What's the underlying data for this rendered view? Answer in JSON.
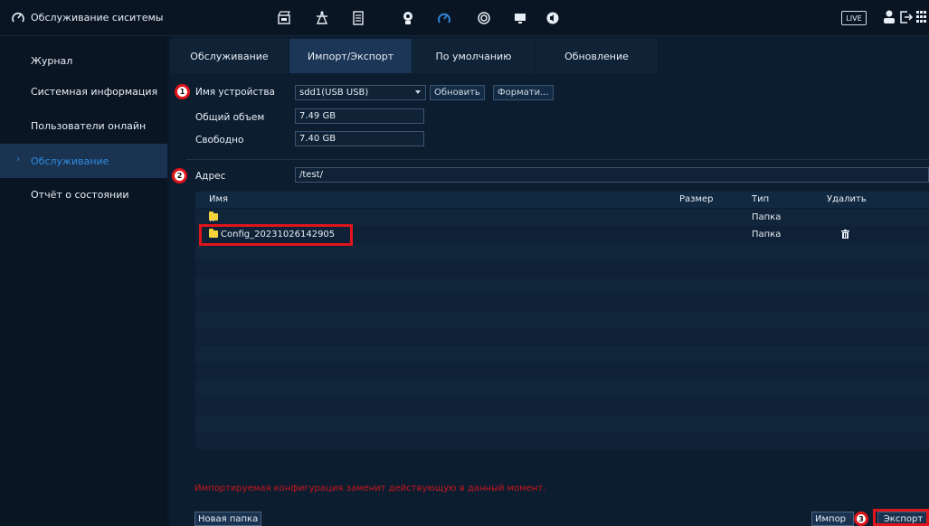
{
  "window": {
    "title": "Обслуживание сиситемы"
  },
  "topbar": {
    "icons": [
      "maintenance-icon",
      "clapper-icon",
      "network-tower-icon",
      "storage-icon",
      "account-security-icon",
      "maintenance-active-icon",
      "display-icon",
      "monitor-icon",
      "audio-icon"
    ],
    "live_label": "LIVE",
    "user_icon": "user-icon",
    "logout_icon": "logout-icon"
  },
  "sidebar": {
    "items": [
      {
        "label": "Журнал"
      },
      {
        "label": "Системная информация"
      },
      {
        "label": "Пользователи онлайн"
      },
      {
        "label": "Обслуживание",
        "active": true
      },
      {
        "label": "Отчёт о состоянии"
      }
    ]
  },
  "tabs": [
    {
      "label": "Обслуживание"
    },
    {
      "label": "Импорт/Экспорт",
      "active": true
    },
    {
      "label": "По умолчанию"
    },
    {
      "label": "Обновление"
    }
  ],
  "device": {
    "name_label": "Имя устройства",
    "name_value": "sdd1(USB USB)",
    "refresh_label": "Обновить",
    "format_label": "Формати...",
    "total_label": "Общий объем",
    "total_value": "7.49 GB",
    "free_label": "Свободно",
    "free_value": "7.40 GB"
  },
  "address": {
    "label": "Адрес",
    "value": "/test/"
  },
  "table": {
    "headers": {
      "name": "Имя",
      "size": "Размер",
      "type": "Тип",
      "delete": "Удалить"
    },
    "rows": [
      {
        "name": "..",
        "size": "",
        "type": "Папка",
        "deletable": false
      },
      {
        "name": "Config_20231026142905",
        "size": "",
        "type": "Папка",
        "deletable": true
      }
    ]
  },
  "badges": [
    "1",
    "2",
    "3"
  ],
  "warning": "Импортируемая конфигурация заменит действующую в данный момент.",
  "buttons": {
    "new_folder": "Новая папка",
    "import": "Импор",
    "export": "Экспорт"
  },
  "colors": {
    "accent": "#2f8ce0",
    "highlight": "#e0141b",
    "warning": "#c7161c",
    "folder": "#f3d23c"
  }
}
